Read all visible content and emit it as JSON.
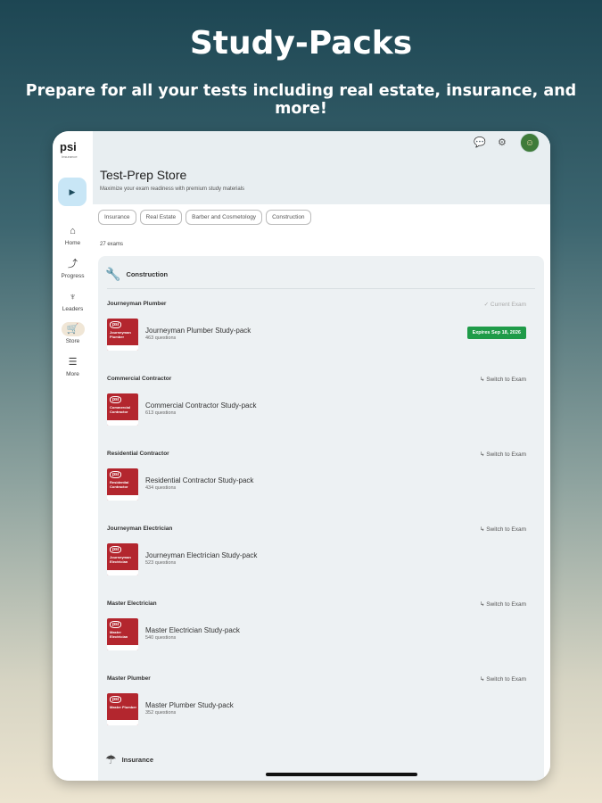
{
  "promo": {
    "title": "Study-Packs",
    "subtitle": "Prepare for all your tests including real estate, insurance, and more!"
  },
  "sidebar": {
    "logo": "psi",
    "logo_small": "Insurance",
    "items": [
      {
        "label": "Home",
        "icon": "home-icon"
      },
      {
        "label": "Progress",
        "icon": "progress-icon"
      },
      {
        "label": "Leaders",
        "icon": "leaders-icon"
      },
      {
        "label": "Store",
        "icon": "cart-icon",
        "active": true
      },
      {
        "label": "More",
        "icon": "menu-icon"
      }
    ]
  },
  "header": {
    "title": "Test-Prep Store",
    "subtitle": "Maximize your exam readiness with premium study materials"
  },
  "filters": [
    "Insurance",
    "Real Estate",
    "Barber and Cosmetology",
    "Construction"
  ],
  "exam_count": "27 exams",
  "categories": [
    {
      "label": "Construction",
      "icon": "tools-icon"
    },
    {
      "label": "Insurance",
      "icon": "umbrella-icon"
    }
  ],
  "exams": [
    {
      "name": "Journeyman Plumber",
      "action": "Current Exam",
      "pack_title": "Journeyman Plumber Study-pack",
      "questions": "463 questions",
      "thumb": "Journeyman Plumber",
      "badge": "Expires Sep 18, 2026"
    },
    {
      "name": "Commercial Contractor",
      "action": "Switch to Exam",
      "pack_title": "Commercial Contractor Study-pack",
      "questions": "613 questions",
      "thumb": "Commercial Contractor"
    },
    {
      "name": "Residential Contractor",
      "action": "Switch to Exam",
      "pack_title": "Residential Contractor Study-pack",
      "questions": "434 questions",
      "thumb": "Residential Contractor"
    },
    {
      "name": "Journeyman Electrician",
      "action": "Switch to Exam",
      "pack_title": "Journeyman Electrician Study-pack",
      "questions": "523 questions",
      "thumb": "Journeyman Electrician"
    },
    {
      "name": "Master Electrician",
      "action": "Switch to Exam",
      "pack_title": "Master Electrician Study-pack",
      "questions": "540 questions",
      "thumb": "Master Electrician"
    },
    {
      "name": "Master Plumber",
      "action": "Switch to Exam",
      "pack_title": "Master Plumber Study-pack",
      "questions": "352 questions",
      "thumb": "Master Plumber"
    }
  ],
  "colors": {
    "badge": "#1f9b48",
    "thumb": "#b3262e",
    "active_nav": "#f0e6d6",
    "fab": "#c8e6f6"
  }
}
